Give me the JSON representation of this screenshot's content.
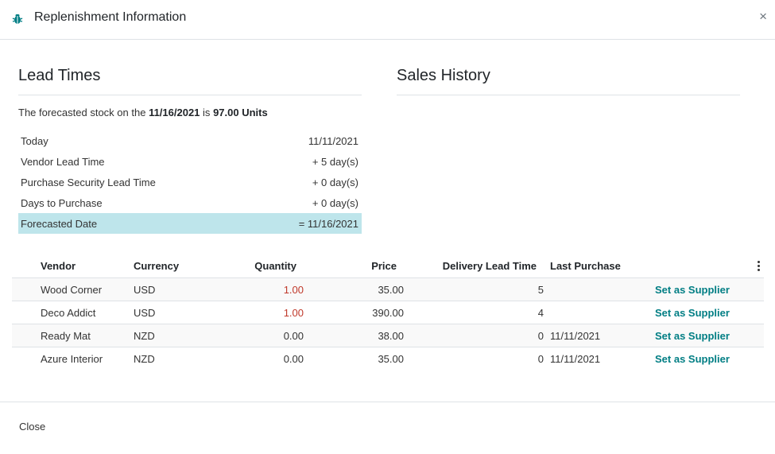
{
  "dialog": {
    "title": "Replenishment Information",
    "close_glyph": "×",
    "icon": "bug-icon"
  },
  "lead_times": {
    "heading": "Lead Times",
    "forecast_prefix": "The forecasted stock on the",
    "forecast_date": "11/16/2021",
    "forecast_mid": "is",
    "forecast_qty": "97.00 Units",
    "rows": [
      {
        "label": "Today",
        "value": "11/11/2021"
      },
      {
        "label": "Vendor Lead Time",
        "value": "+ 5 day(s)"
      },
      {
        "label": "Purchase Security Lead Time",
        "value": "+ 0 day(s)"
      },
      {
        "label": "Days to Purchase",
        "value": "+ 0 day(s)"
      },
      {
        "label": "Forecasted Date",
        "value": "= 11/16/2021"
      }
    ]
  },
  "sales_history": {
    "heading": "Sales History"
  },
  "suppliers": {
    "columns": {
      "vendor": "Vendor",
      "currency": "Currency",
      "quantity": "Quantity",
      "price": "Price",
      "delivery_lead_time": "Delivery Lead Time",
      "last_purchase": "Last Purchase"
    },
    "rows": [
      {
        "vendor": "Wood Corner",
        "currency": "USD",
        "quantity": "1.00",
        "price": "35.00",
        "delay": "5",
        "last_purchase": "",
        "action": "Set as Supplier"
      },
      {
        "vendor": "Deco Addict",
        "currency": "USD",
        "quantity": "1.00",
        "price": "390.00",
        "delay": "4",
        "last_purchase": "",
        "action": "Set as Supplier"
      },
      {
        "vendor": "Ready Mat",
        "currency": "NZD",
        "quantity": "0.00",
        "price": "38.00",
        "delay": "0",
        "last_purchase": "11/11/2021",
        "action": "Set as Supplier"
      },
      {
        "vendor": "Azure Interior",
        "currency": "NZD",
        "quantity": "0.00",
        "price": "35.00",
        "delay": "0",
        "last_purchase": "11/11/2021",
        "action": "Set as Supplier"
      }
    ]
  },
  "footer": {
    "close_label": "Close"
  },
  "colors": {
    "accent": "#017e84",
    "highlight_row": "#bee5eb",
    "quantity_alert": "#c0392b"
  }
}
